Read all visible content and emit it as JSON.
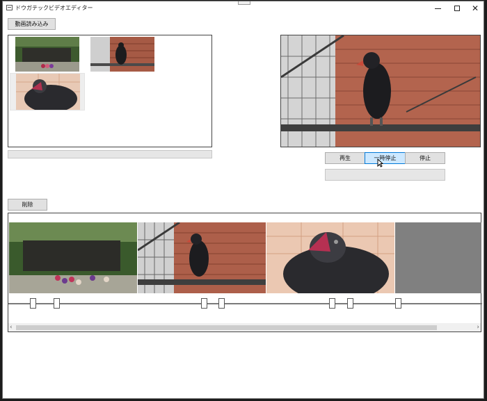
{
  "window": {
    "title": "ドウガテックビデオエディター",
    "minimize_icon": "minimize-icon",
    "maximize_icon": "maximize-icon",
    "close_icon": "close-icon"
  },
  "toolbar": {
    "load_button": "動画読み込み"
  },
  "playback": {
    "play": "再生",
    "pause": "一時停止",
    "stop": "停止"
  },
  "timeline": {
    "delete_button": "削除"
  },
  "colors": {
    "accent": "#cce8ff",
    "button_bg": "#e1e1e1",
    "frame_border": "#444444",
    "empty_frame": "#808080"
  },
  "scrollbar": {
    "left_arrow": "‹",
    "right_arrow": "›"
  }
}
